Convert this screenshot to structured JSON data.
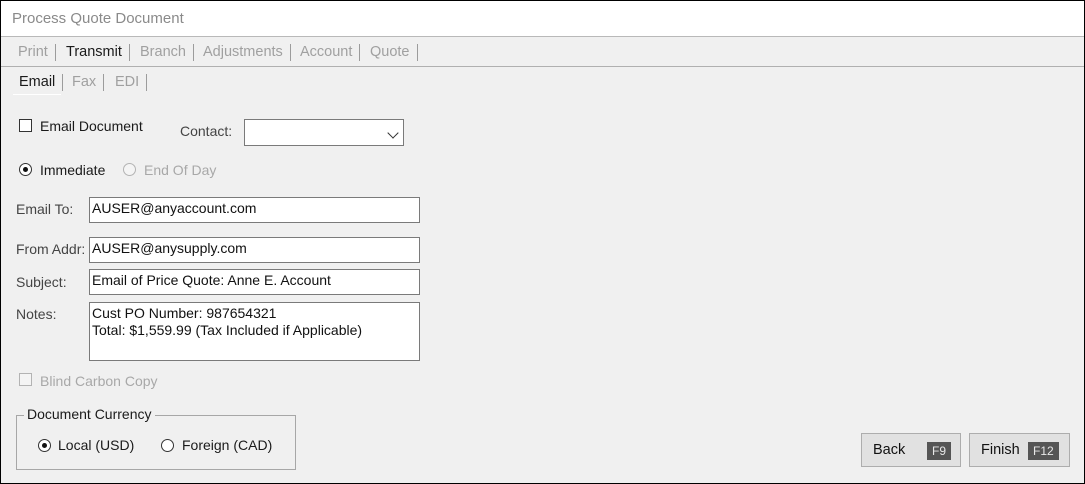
{
  "window": {
    "title": "Process Quote Document"
  },
  "main_tabs": [
    {
      "label": "Print",
      "state": "disabled"
    },
    {
      "label": "Transmit",
      "state": "active"
    },
    {
      "label": "Branch",
      "state": "disabled"
    },
    {
      "label": "Adjustments",
      "state": "disabled"
    },
    {
      "label": "Account",
      "state": "disabled"
    },
    {
      "label": "Quote",
      "state": "disabled"
    }
  ],
  "sub_tabs": [
    {
      "label": "Email",
      "state": "active"
    },
    {
      "label": "Fax",
      "state": "disabled"
    },
    {
      "label": "EDI",
      "state": "disabled"
    }
  ],
  "email_document": {
    "label": "Email Document",
    "checked": false
  },
  "contact": {
    "label": "Contact:",
    "value": ""
  },
  "timing": {
    "immediate_label": "Immediate",
    "end_of_day_label": "End Of Day",
    "selected": "Immediate"
  },
  "fields": {
    "email_to": {
      "label": "Email To:",
      "value": "AUSER@anyaccount.com"
    },
    "from_addr": {
      "label": "From Addr:",
      "value": "AUSER@anysupply.com"
    },
    "subject": {
      "label": "Subject:",
      "value": "Email of Price Quote: Anne E. Account"
    },
    "notes": {
      "label": "Notes:",
      "value": "Cust PO Number: 987654321\nTotal: $1,559.99 (Tax Included if Applicable)"
    }
  },
  "bcc": {
    "label": "Blind Carbon Copy",
    "checked": false,
    "enabled": false
  },
  "currency": {
    "title": "Document Currency",
    "local_label": "Local (USD)",
    "foreign_label": "Foreign (CAD)",
    "selected": "Local (USD)"
  },
  "buttons": {
    "back": {
      "label": "Back",
      "key": "F9"
    },
    "finish": {
      "label": "Finish",
      "key": "F12"
    }
  },
  "colors": {
    "window_bg": "#f0f0f0",
    "title_text": "#8a8a8a",
    "disabled_text": "#a0a0a0",
    "key_badge_bg": "#555555"
  }
}
